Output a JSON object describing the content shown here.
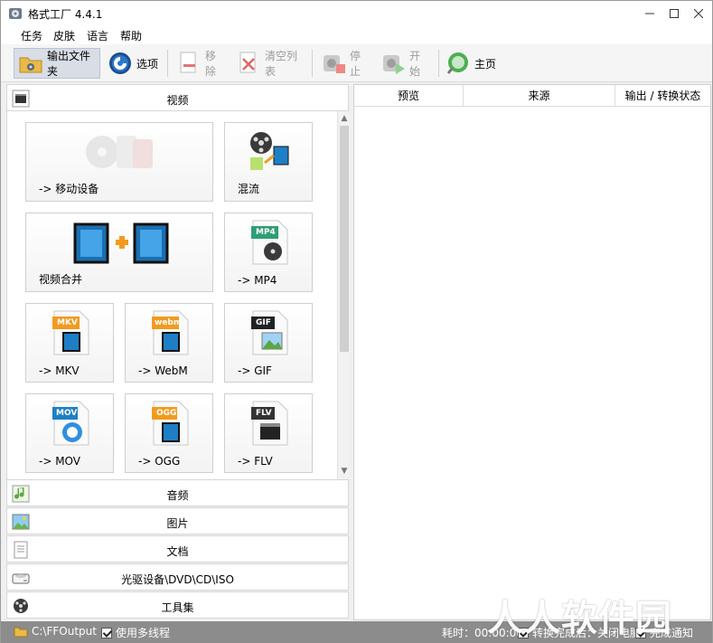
{
  "window": {
    "title": "格式工厂 4.4.1"
  },
  "menu": [
    "任务",
    "皮肤",
    "语言",
    "帮助"
  ],
  "toolbar": {
    "output_folder": "输出文件夹",
    "options": "选项",
    "remove": "移除",
    "clear_list": "清空列表",
    "stop": "停止",
    "start": "开始",
    "home": "主页"
  },
  "categories": {
    "video": "视频",
    "audio": "音频",
    "image": "图片",
    "document": "文档",
    "optical": "光驱设备\\DVD\\CD\\ISO",
    "tools": "工具集"
  },
  "tiles": {
    "mobile": "-> 移动设备",
    "mux": "混流",
    "merge": "视频合并",
    "mp4": "-> MP4",
    "mkv": "-> MKV",
    "webm": "-> WebM",
    "gif": "-> GIF",
    "mov": "-> MOV",
    "ogg": "-> OGG",
    "flv": "-> FLV"
  },
  "badges": {
    "mp4": "MP4",
    "mkv": "MKV",
    "webm": "webm",
    "gif": "GIF",
    "mov": "MOV",
    "ogg": "OGG",
    "flv": "FLV"
  },
  "task_table": {
    "columns": [
      "预览",
      "来源",
      "输出 / 转换状态"
    ]
  },
  "status": {
    "output_path": "C:\\FFOutput",
    "multithread": "使用多线程",
    "elapsed": "耗时：00:00:00",
    "after_convert": "转换完成后：关闭电脑",
    "complete_notify": "完成通知"
  },
  "watermark": "人人软件园",
  "colors": {
    "accent_orange": "#f39a1e",
    "film_blue": "#1e7fc6",
    "statusbar": "#8c8c8c",
    "green": "#3fa535"
  }
}
